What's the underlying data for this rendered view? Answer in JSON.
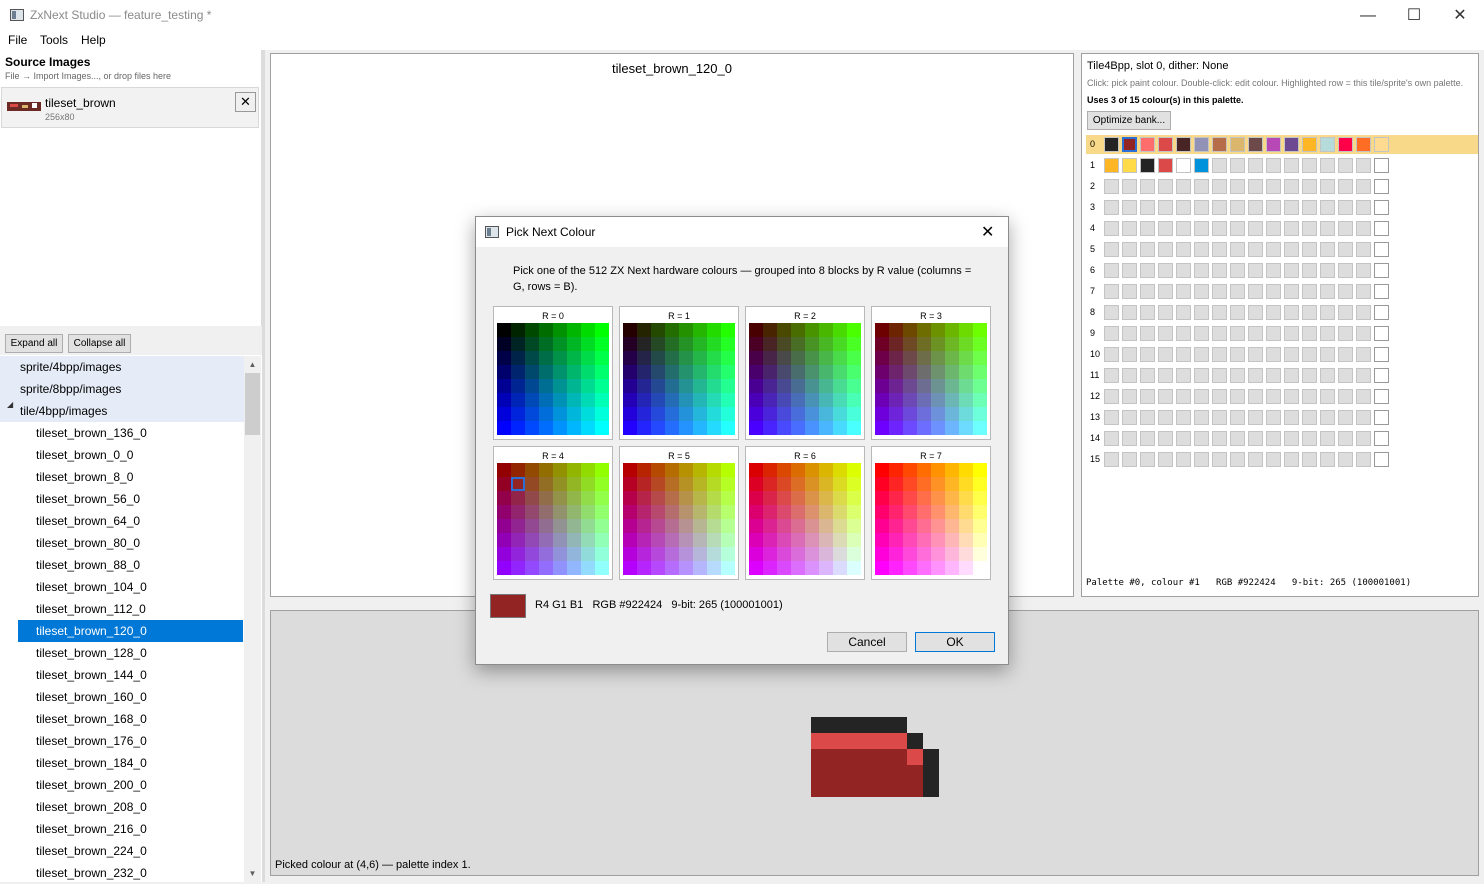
{
  "window": {
    "title": "ZxNext Studio — feature_testing *",
    "controls": {
      "minimize": "—",
      "maximize": "☐",
      "close": "✕"
    }
  },
  "menu": [
    "File",
    "Tools",
    "Help"
  ],
  "source_images": {
    "title": "Source Images",
    "hint": "File → Import Images..., or drop files here",
    "items": [
      {
        "name": "tileset_brown",
        "size": "256x80"
      }
    ],
    "remove_glyph": "✕"
  },
  "tree": {
    "expand_all": "Expand all",
    "collapse_all": "Collapse all",
    "groups": [
      "sprite/4bpp/images",
      "sprite/8bpp/images",
      "tile/4bpp/images"
    ],
    "expander_glyph": "◢",
    "items": [
      "tileset_brown_136_0",
      "tileset_brown_0_0",
      "tileset_brown_8_0",
      "tileset_brown_56_0",
      "tileset_brown_64_0",
      "tileset_brown_80_0",
      "tileset_brown_88_0",
      "tileset_brown_104_0",
      "tileset_brown_112_0",
      "tileset_brown_120_0",
      "tileset_brown_128_0",
      "tileset_brown_144_0",
      "tileset_brown_160_0",
      "tileset_brown_168_0",
      "tileset_brown_176_0",
      "tileset_brown_184_0",
      "tileset_brown_200_0",
      "tileset_brown_208_0",
      "tileset_brown_216_0",
      "tileset_brown_224_0",
      "tileset_brown_232_0"
    ],
    "selected": "tileset_brown_120_0",
    "scroll_up": "▲",
    "scroll_down": "▼"
  },
  "canvas": {
    "title": "tileset_brown_120_0"
  },
  "palette_panel": {
    "header": "Tile4Bpp, slot 0, dither: None",
    "help": "Click: pick paint colour. Double-click: edit colour. Highlighted row = this tile/sprite's own palette.",
    "usage": "Uses 3 of 15 colour(s) in this palette.",
    "optimize_button": "Optimize bank...",
    "rows": [
      {
        "index": "0",
        "highlighted": true,
        "colors": [
          "#242424",
          "#922424",
          "#ff6d6d",
          "#db4949",
          "#492424",
          "#9292b6",
          "#b66d49",
          "#dbb66d",
          "#6d4949",
          "#b649b6",
          "#6d4992",
          "#ffb624",
          "#b6dbdb",
          "#ff0049",
          "#ff6d24",
          "#ffdb92"
        ]
      },
      {
        "index": "1",
        "highlighted": false,
        "colors": [
          "#ffb624",
          "#ffdb49",
          "#242424",
          "#db4949",
          "#ffffff",
          "#0092db"
        ]
      },
      {
        "index": "2",
        "highlighted": false,
        "colors": []
      },
      {
        "index": "3",
        "highlighted": false,
        "colors": []
      },
      {
        "index": "4",
        "highlighted": false,
        "colors": []
      },
      {
        "index": "5",
        "highlighted": false,
        "colors": []
      },
      {
        "index": "6",
        "highlighted": false,
        "colors": []
      },
      {
        "index": "7",
        "highlighted": false,
        "colors": []
      },
      {
        "index": "8",
        "highlighted": false,
        "colors": []
      },
      {
        "index": "9",
        "highlighted": false,
        "colors": []
      },
      {
        "index": "10",
        "highlighted": false,
        "colors": []
      },
      {
        "index": "11",
        "highlighted": false,
        "colors": []
      },
      {
        "index": "12",
        "highlighted": false,
        "colors": []
      },
      {
        "index": "13",
        "highlighted": false,
        "colors": []
      },
      {
        "index": "14",
        "highlighted": false,
        "colors": []
      },
      {
        "index": "15",
        "highlighted": false,
        "colors": []
      }
    ],
    "selected_swatch": {
      "row": 0,
      "col": 1
    },
    "empty_color": "#dddddd",
    "last_color": "#ffffff",
    "highlight_color": "#f8d98a",
    "status": "Palette #0, colour #1   RGB #922424   9-bit: 265 (100001001)"
  },
  "preview": {
    "status": "Picked colour at (4,6) — palette index 1."
  },
  "dialog": {
    "title": "Pick Next Colour",
    "close_glyph": "✕",
    "description": "Pick one of the 512 ZX Next hardware colours — grouped into 8 blocks by R value (columns = G, rows = B).",
    "blocks": [
      "R = 0",
      "R = 1",
      "R = 2",
      "R = 3",
      "R = 4",
      "R = 5",
      "R = 6",
      "R = 7"
    ],
    "selected": {
      "r": 4,
      "g": 1,
      "b": 1
    },
    "selected_color": "#922424",
    "readout": "R4 G1 B1   RGB #922424   9-bit: 265 (100001001)",
    "cancel": "Cancel",
    "ok": "OK"
  }
}
